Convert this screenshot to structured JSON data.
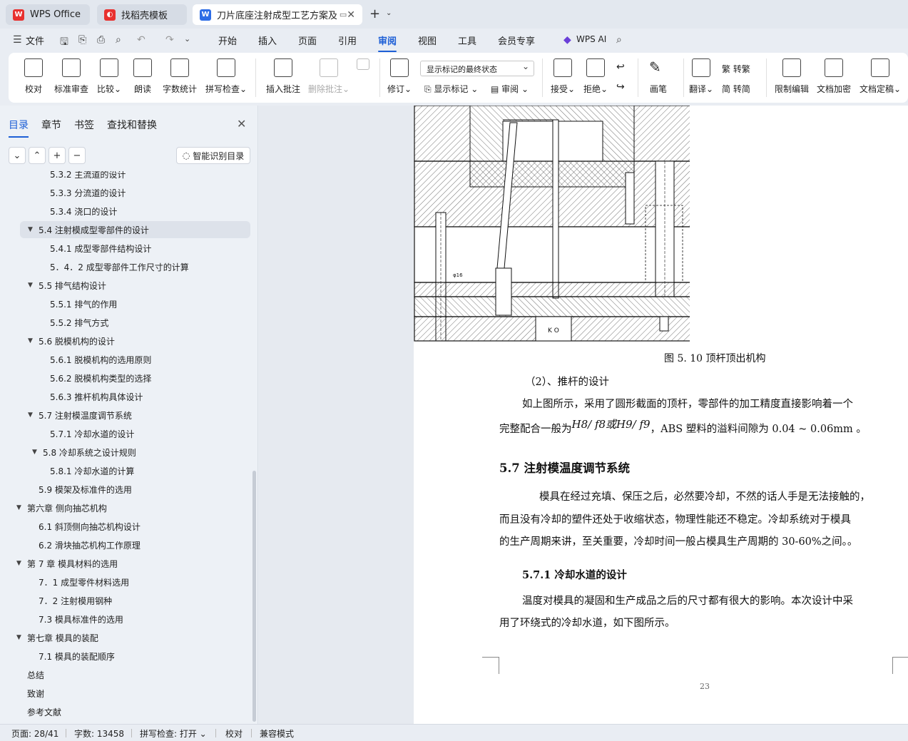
{
  "tabs": [
    {
      "label": "WPS Office"
    },
    {
      "label": "找稻壳模板"
    },
    {
      "label": "刀片底座注射成型工艺方案及模具设计"
    }
  ],
  "menu": {
    "file": "文件",
    "items": [
      "开始",
      "插入",
      "页面",
      "引用",
      "审阅",
      "视图",
      "工具",
      "会员专享"
    ],
    "active": "审阅",
    "ai": "WPS AI"
  },
  "ribbon": {
    "proofread": "校对",
    "std_review": "标准审查",
    "compare": "比较",
    "read_aloud": "朗读",
    "word_count": "字数统计",
    "spell_check": "拼写检查",
    "insert_comment": "插入批注",
    "delete_comment": "删除批注",
    "revise": "修订",
    "markup_select": "显示标记的最终状态",
    "show_markup": "显示标记",
    "review_pane": "审阅",
    "accept": "接受",
    "reject": "拒绝",
    "ink": "画笔",
    "translate": "翻译",
    "to_traditional": "转繁",
    "to_simplified": "转简",
    "restrict_edit": "限制编辑",
    "doc_encrypt": "文档加密",
    "doc_finalize": "文档定稿"
  },
  "panel": {
    "tabs": [
      "目录",
      "章节",
      "书签",
      "查找和替换"
    ],
    "smart_toc": "智能识别目录",
    "toc": [
      {
        "text": "5.3.2   主流道的设计",
        "level": 3
      },
      {
        "text": "5.3.3   分流道的设计",
        "level": 3
      },
      {
        "text": "5.3.4   浇口的设计",
        "level": 3
      },
      {
        "text": "5.4   注射模成型零部件的设计",
        "level": 2,
        "expanded": true,
        "selected": true
      },
      {
        "text": "5.4.1  成型零部件结构设计",
        "level": 3
      },
      {
        "text": "5．4．2   成型零部件工作尺寸的计算",
        "level": 3
      },
      {
        "text": "5.5   排气结构设计",
        "level": 2,
        "expanded": true
      },
      {
        "text": "5.5.1 排气的作用",
        "level": 3
      },
      {
        "text": "5.5.2 排气方式",
        "level": 3
      },
      {
        "text": "5.6   脱模机构的设计",
        "level": 2,
        "expanded": true
      },
      {
        "text": "5.6.1   脱模机构的选用原则",
        "level": 3
      },
      {
        "text": "5.6.2   脱模机构类型的选择",
        "level": 3
      },
      {
        "text": "5.6.3   推杆机构具体设计",
        "level": 3
      },
      {
        "text": "5.7  注射模温度调节系统",
        "level": 2,
        "expanded": true
      },
      {
        "text": "5.7.1   冷却水道的设计",
        "level": 3
      },
      {
        "text": "5.8  冷却系统之设计规则",
        "level": 2,
        "expanded": true,
        "indent_extra": true
      },
      {
        "text": "5.8.1 冷却水道的计算",
        "level": 3
      },
      {
        "text": "5.9    模架及标准件的选用",
        "level": 2
      },
      {
        "text": "第六章  侧向抽芯机构",
        "level": 1,
        "expanded": true
      },
      {
        "text": "6.1   斜顶侧向抽芯机构设计",
        "level": 2
      },
      {
        "text": "6.2  滑块抽芯机构工作原理",
        "level": 2
      },
      {
        "text": "第 7 章    模具材料的选用",
        "level": 1,
        "expanded": true
      },
      {
        "text": "7．1    成型零件材料选用",
        "level": 2
      },
      {
        "text": "7．2    注射模用钢种",
        "level": 2
      },
      {
        "text": "7.3  模具标准件的选用",
        "level": 2
      },
      {
        "text": "第七章    模具的装配",
        "level": 1,
        "expanded": true
      },
      {
        "text": "7.1  模具的装配顺序",
        "level": 2
      },
      {
        "text": "总结",
        "level": 1
      },
      {
        "text": "致谢",
        "level": 1
      },
      {
        "text": "参考文献",
        "level": 1
      }
    ]
  },
  "document": {
    "drawing_label_1": "φ16",
    "drawing_label_2": "K O",
    "figure_caption": "图 5. 10  顶杆顶出机构",
    "item2": "（2）、推杆的设计",
    "para1_line1": "如上图所示，采用了圆形截面的顶杆，零部件的加工精度直接影响着一个",
    "para1_line2_a": "完整配合一般为",
    "para1_formula": "H8/ f8或H9/ f9",
    "para1_line2_b": "，ABS 塑料的溢料间隙为 0.04 ~ 0.06mm 。",
    "heading_57": "5.7  注射模温度调节系统",
    "para2_line1": "模具在经过充填、保压之后，必然要冷却，不然的话人手是无法接触的，",
    "para2_line2": "而且没有冷却的塑件还处于收缩状态，物理性能还不稳定。冷却系统对于模具",
    "para2_line3": "的生产周期来讲，至关重要，冷却时间一般占模具生产周期的 30-60%之间。。",
    "heading_571": "5.7.1    冷却水道的设计",
    "para3_line1": "温度对模具的凝固和生产成品之后的尺寸都有很大的影响。本次设计中采",
    "para3_line2": "用了环绕式的冷却水道，如下图所示。",
    "page_number": "23"
  },
  "status": {
    "page": "页面: 28/41",
    "words": "字数: 13458",
    "spell": "拼写检查: 打开",
    "proof": "校对",
    "compat": "兼容模式"
  }
}
